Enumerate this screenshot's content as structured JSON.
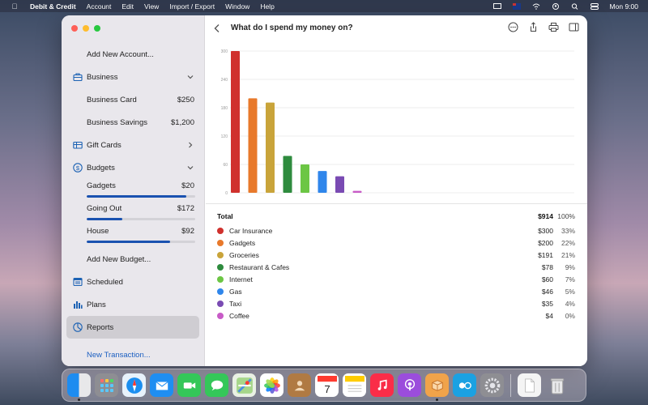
{
  "menubar": {
    "app_name": "Debit & Credit",
    "items": [
      "Account",
      "Edit",
      "View",
      "Import / Export",
      "Window",
      "Help"
    ],
    "clock": "Mon 9:00"
  },
  "sidebar": {
    "add_account": "Add New Account...",
    "business": {
      "label": "Business",
      "accounts": [
        {
          "name": "Business Card",
          "value": "$250"
        },
        {
          "name": "Business Savings",
          "value": "$1,200"
        }
      ]
    },
    "gift_cards": "Gift Cards",
    "budgets": {
      "label": "Budgets",
      "items": [
        {
          "name": "Gadgets",
          "value": "$20",
          "progress": 0.92
        },
        {
          "name": "Going Out",
          "value": "$172",
          "progress": 0.33
        },
        {
          "name": "House",
          "value": "$92",
          "progress": 0.77
        }
      ],
      "add_budget": "Add New Budget..."
    },
    "scheduled": "Scheduled",
    "plans": "Plans",
    "reports": "Reports",
    "new_transaction": "New Transaction..."
  },
  "main": {
    "title": "What do I spend my money on?",
    "total_label": "Total",
    "total_amount": "$914",
    "total_pct": "100%"
  },
  "chart_data": {
    "type": "bar",
    "categories": [
      "Car Insurance",
      "Gadgets",
      "Groceries",
      "Restaurant & Cafes",
      "Internet",
      "Gas",
      "Taxi",
      "Coffee"
    ],
    "values": [
      300,
      200,
      191,
      78,
      60,
      46,
      35,
      4
    ],
    "colors": [
      "#d0312d",
      "#e8792b",
      "#c9a43a",
      "#2e8b3e",
      "#6cc644",
      "#2f86eb",
      "#7a4bb3",
      "#c85bc7"
    ],
    "amounts": [
      "$300",
      "$200",
      "$191",
      "$78",
      "$60",
      "$46",
      "$35",
      "$4"
    ],
    "percents": [
      "33%",
      "22%",
      "21%",
      "9%",
      "7%",
      "5%",
      "4%",
      "0%"
    ],
    "yticks": [
      "300",
      "240",
      "180",
      "120",
      "60",
      "0"
    ],
    "ylim": [
      0,
      300
    ],
    "grid": true
  }
}
